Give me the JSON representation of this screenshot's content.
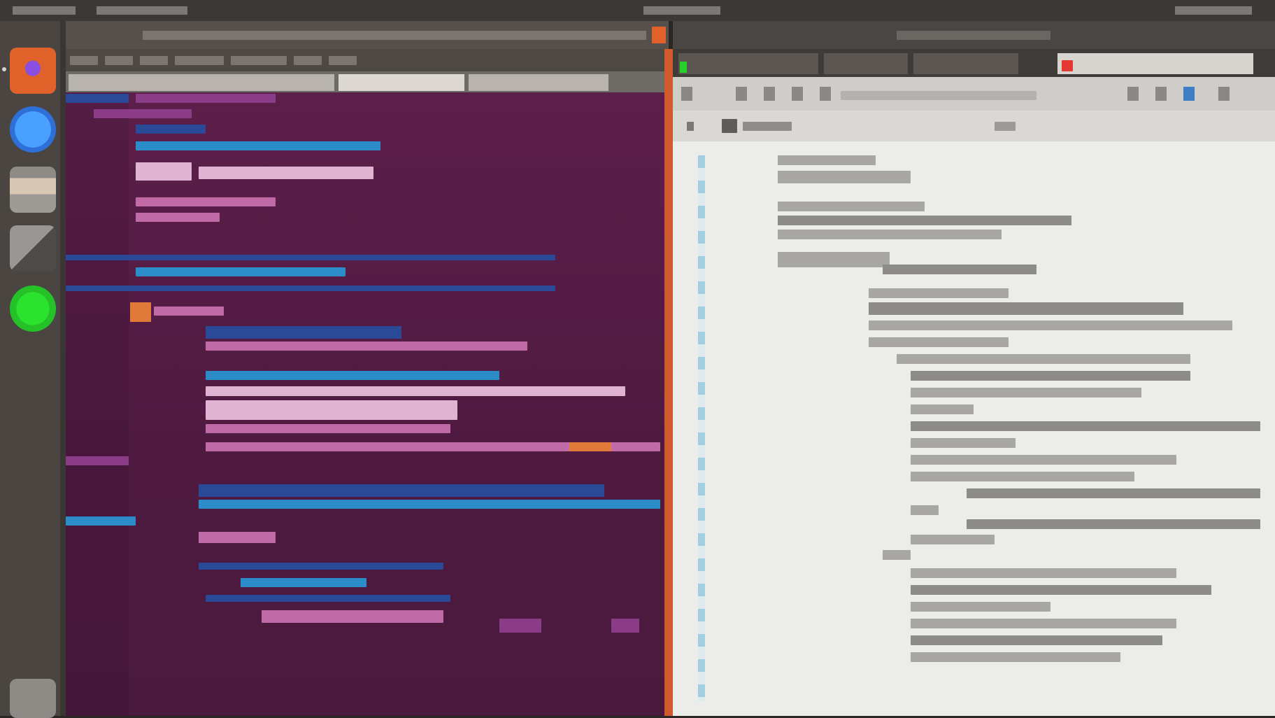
{
  "screen": {
    "accent": "#5a1c48",
    "panel_accent": "#d05a2c"
  },
  "launcher": {
    "items": [
      {
        "name": "firefox-icon",
        "color": "#e0622a"
      },
      {
        "name": "browser-icon",
        "color": "#2f7fe8"
      },
      {
        "name": "files-icon",
        "color": "#d9c7b6"
      },
      {
        "name": "app-icon",
        "color": "#6b6764"
      },
      {
        "name": "software-icon",
        "color": "#25c227"
      },
      {
        "name": "trash-icon",
        "color": "#8e8a86"
      }
    ]
  },
  "left_window": {
    "kind": "code-editor",
    "theme": "ubergine"
  },
  "right_window": {
    "kind": "document-viewer",
    "active_tab_indicator": "#e53935"
  }
}
